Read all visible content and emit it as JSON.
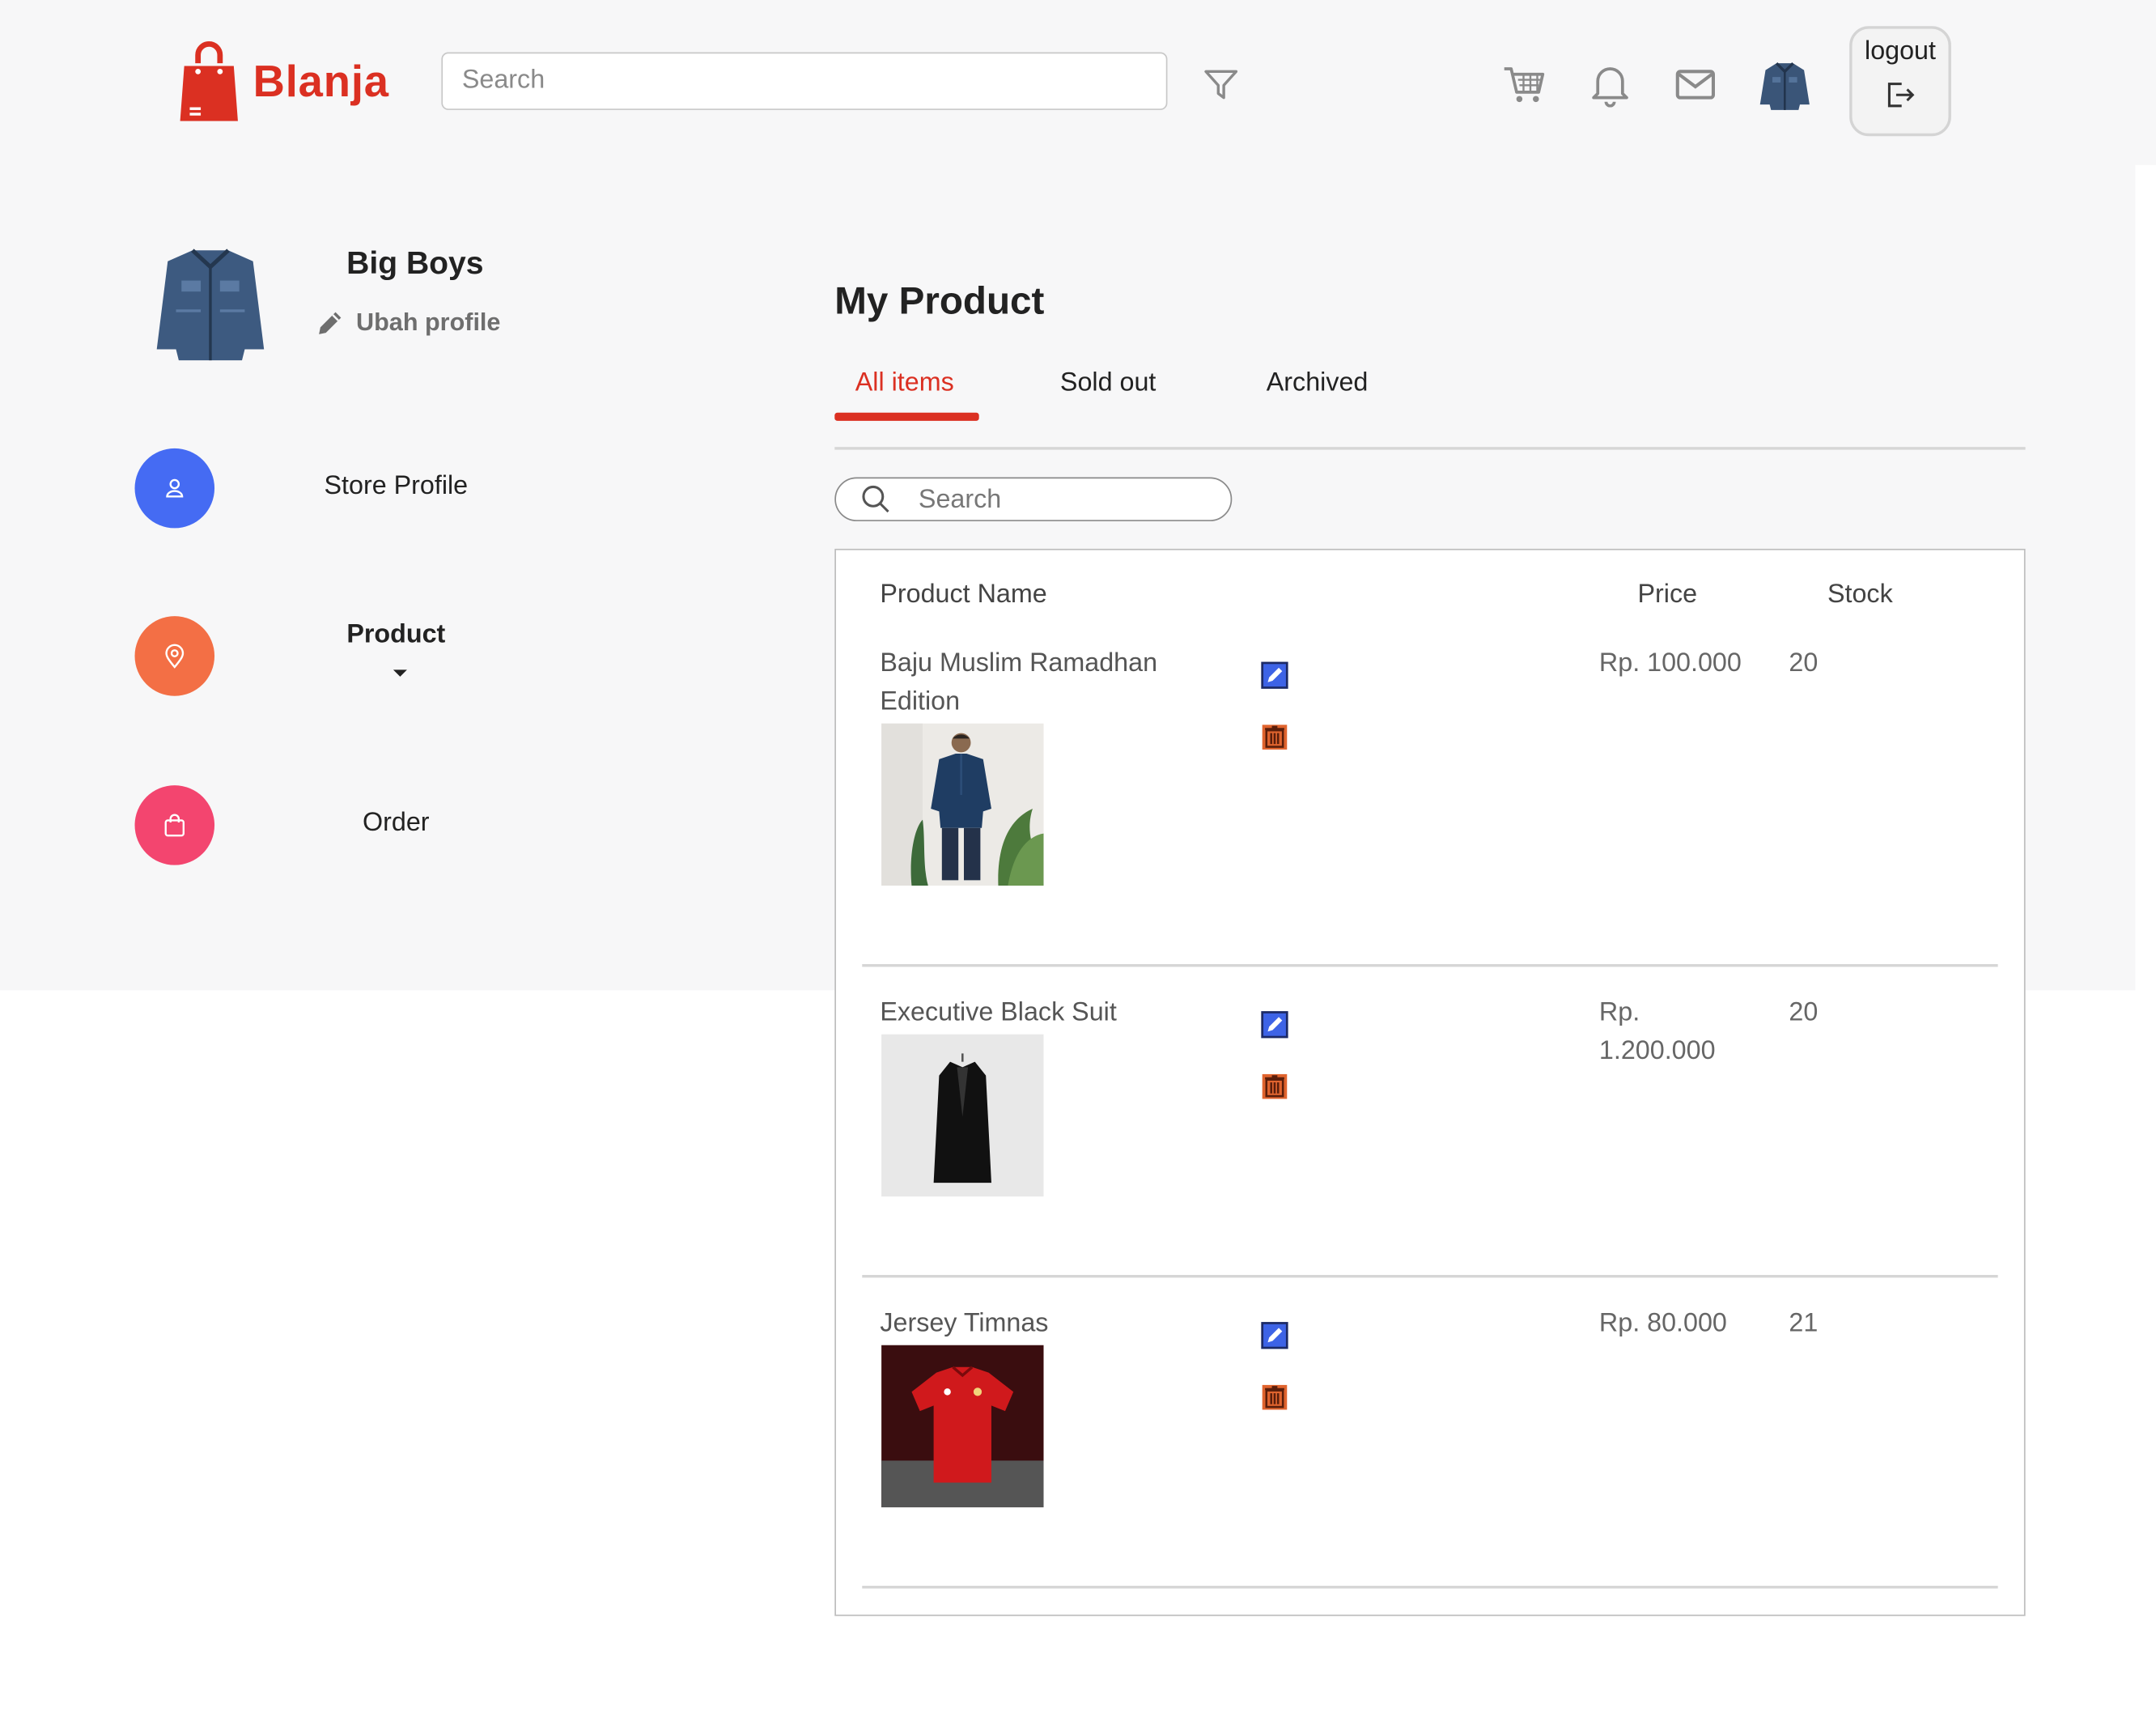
{
  "header": {
    "brand": "Blanja",
    "search_placeholder": "Search",
    "logout_label": "logout"
  },
  "sidebar": {
    "shop_name": "Big Boys",
    "edit_profile_label": "Ubah profile",
    "items": [
      {
        "label": "Store Profile",
        "color": "#456bf3"
      },
      {
        "label": "Product",
        "color": "#f36f45"
      },
      {
        "label": "Order",
        "color": "#f3456f"
      }
    ]
  },
  "main": {
    "title": "My Product",
    "tabs": [
      {
        "label": "All items",
        "active": true
      },
      {
        "label": "Sold out",
        "active": false
      },
      {
        "label": "Archived",
        "active": false
      }
    ],
    "search_placeholder": "Search",
    "table": {
      "columns": [
        "Product Name",
        "Price",
        "Stock"
      ],
      "rows": [
        {
          "name": "Baju Muslim Ramadhan Edition",
          "price": "Rp. 100.000",
          "stock": "20"
        },
        {
          "name": "Executive Black Suit",
          "price": "Rp. 1.200.000",
          "stock": "20"
        },
        {
          "name": "Jersey Timnas",
          "price": "Rp. 80.000",
          "stock": "21"
        }
      ]
    }
  },
  "colors": {
    "accent": "#db3022",
    "edit_icon": "#3d63e6",
    "delete_icon": "#e0642e"
  }
}
